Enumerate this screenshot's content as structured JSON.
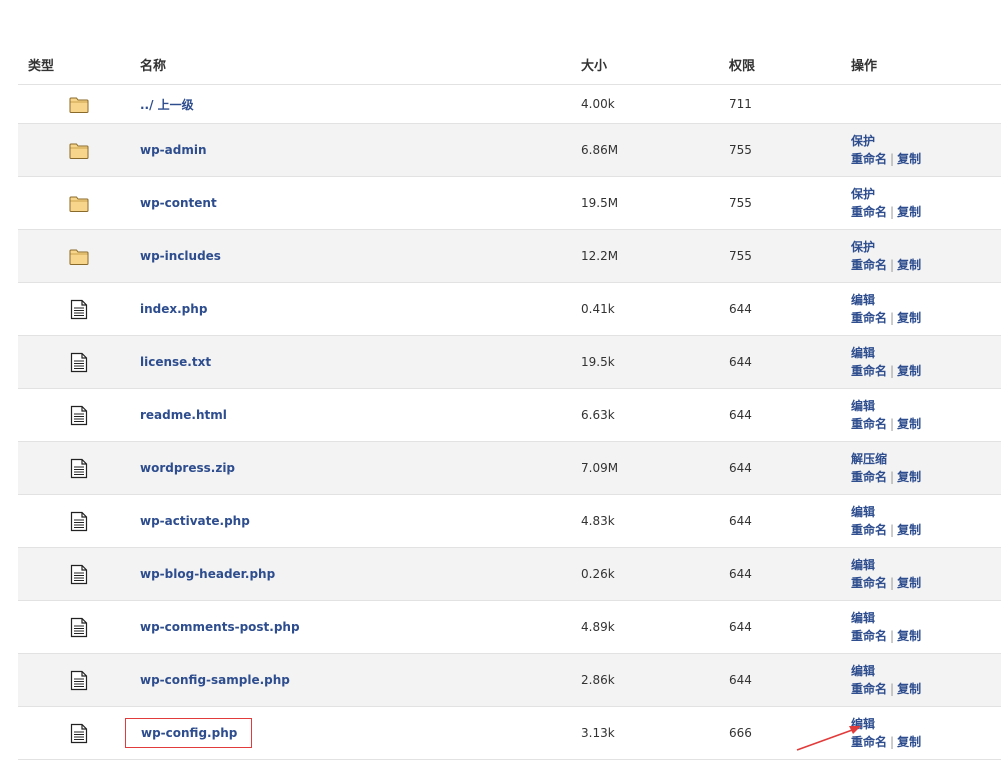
{
  "headers": {
    "type": "类型",
    "name": "名称",
    "size": "大小",
    "perm": "权限",
    "ops": "操作"
  },
  "parent": {
    "icon": "folder-icon",
    "name": "../ 上一级",
    "size": "4.00k",
    "perm": "711"
  },
  "ops_labels": {
    "rename": "重命名",
    "copy": "复制",
    "separator": "|"
  },
  "rows": [
    {
      "icon": "folder-icon",
      "name": "wp-admin",
      "size": "6.86M",
      "perm": "755",
      "primary": "保护"
    },
    {
      "icon": "folder-icon",
      "name": "wp-content",
      "size": "19.5M",
      "perm": "755",
      "primary": "保护"
    },
    {
      "icon": "folder-icon",
      "name": "wp-includes",
      "size": "12.2M",
      "perm": "755",
      "primary": "保护"
    },
    {
      "icon": "file-icon",
      "name": "index.php",
      "size": "0.41k",
      "perm": "644",
      "primary": "编辑"
    },
    {
      "icon": "file-icon",
      "name": "license.txt",
      "size": "19.5k",
      "perm": "644",
      "primary": "编辑"
    },
    {
      "icon": "file-icon",
      "name": "readme.html",
      "size": "6.63k",
      "perm": "644",
      "primary": "编辑"
    },
    {
      "icon": "file-icon",
      "name": "wordpress.zip",
      "size": "7.09M",
      "perm": "644",
      "primary": "解压缩"
    },
    {
      "icon": "file-icon",
      "name": "wp-activate.php",
      "size": "4.83k",
      "perm": "644",
      "primary": "编辑"
    },
    {
      "icon": "file-icon",
      "name": "wp-blog-header.php",
      "size": "0.26k",
      "perm": "644",
      "primary": "编辑"
    },
    {
      "icon": "file-icon",
      "name": "wp-comments-post.php",
      "size": "4.89k",
      "perm": "644",
      "primary": "编辑"
    },
    {
      "icon": "file-icon",
      "name": "wp-config-sample.php",
      "size": "2.86k",
      "perm": "644",
      "primary": "编辑"
    },
    {
      "icon": "file-icon",
      "name": "wp-config.php",
      "size": "3.13k",
      "perm": "666",
      "primary": "编辑",
      "highlighted": true
    }
  ],
  "colors": {
    "link": "#2d4d8e",
    "row_alt": "#f3f3f3",
    "border": "#e2e2e2",
    "highlight": "#e23b3b"
  }
}
